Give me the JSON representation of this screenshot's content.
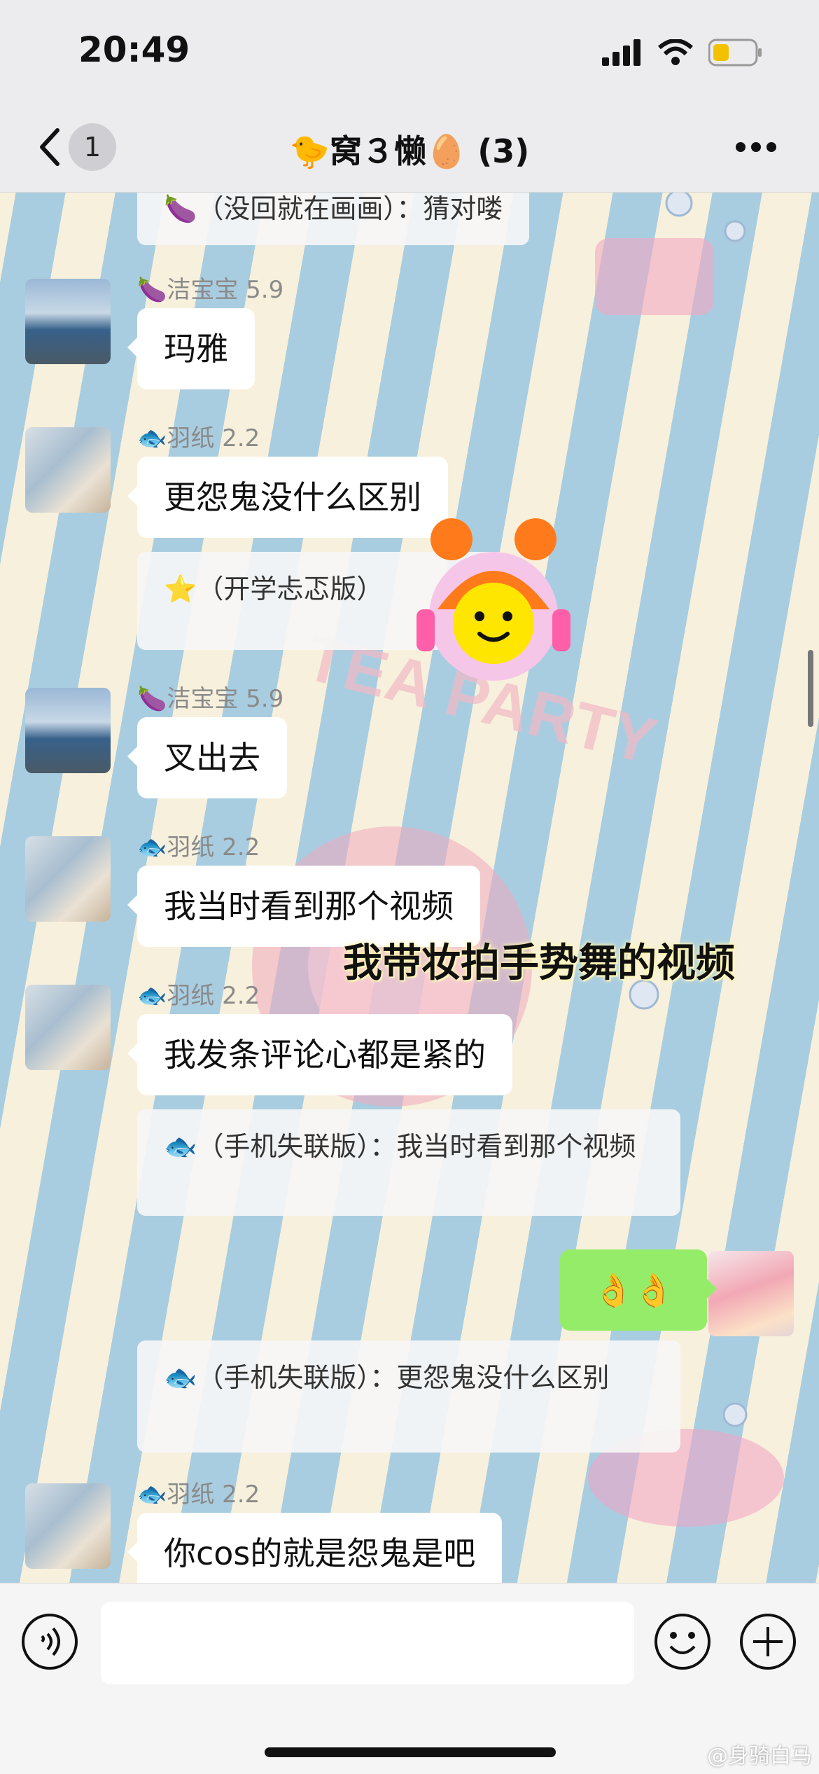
{
  "status_bar": {
    "time": "20:49"
  },
  "nav": {
    "unread_count": "1",
    "title": "🐤窝３懒🥚 (3)"
  },
  "messages": {
    "quote_top": "🍆（没回就在画画）：猜对喽",
    "m1": {
      "sender": "🍆洁宝宝 5.9",
      "text": "玛雅"
    },
    "m2": {
      "sender": "🐟羽纸 2.2",
      "text": "更怨鬼没什么区别",
      "quote": "⭐（开学忐忑版）"
    },
    "m3": {
      "sender": "🍆洁宝宝 5.9",
      "text": "叉出去"
    },
    "m4": {
      "sender": "🐟羽纸 2.2",
      "text": "我当时看到那个视频"
    },
    "m5": {
      "sender": "🐟羽纸 2.2",
      "text": "我发条评论心都是紧的",
      "quote": "🐟（手机失联版）：我当时看到那个视频"
    },
    "self": {
      "text": "👌👌",
      "quote": "🐟（手机失联版）：更怨鬼没什么区别"
    },
    "m6": {
      "sender": "🐟羽纸 2.2",
      "text": "你cos的就是怨鬼是吧"
    }
  },
  "caption": "我带妆拍手势舞的视频",
  "wallpaper_text": "TEA PARTY",
  "watermark": "@身骑白马",
  "input": {
    "placeholder": ""
  },
  "colors": {
    "self_bubble": "#95ec69",
    "bubble": "#ffffff",
    "bar": "#ececee"
  }
}
